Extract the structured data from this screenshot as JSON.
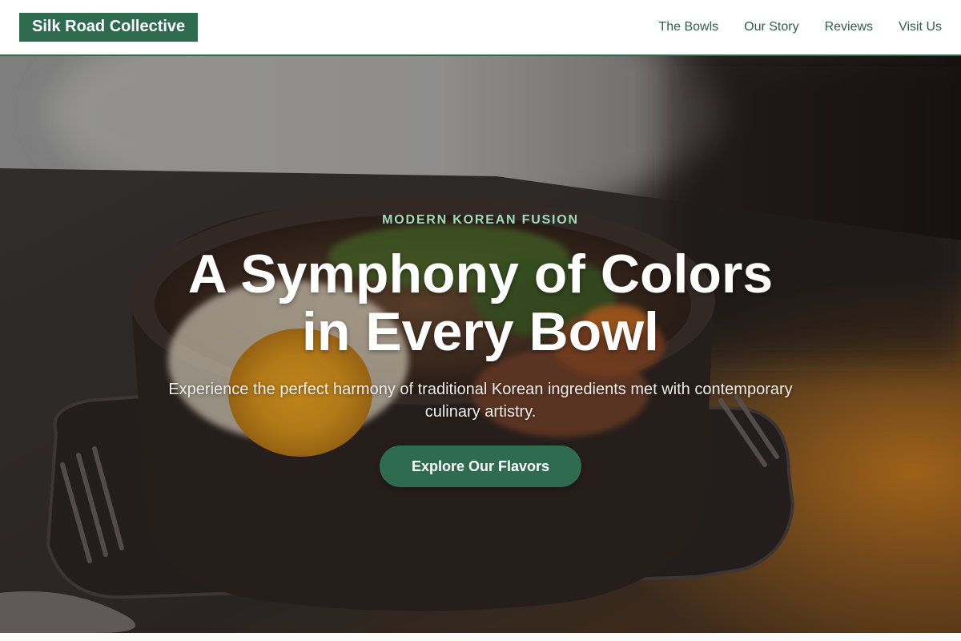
{
  "header": {
    "logo": "Silk Road Collective",
    "nav": [
      {
        "label": "The Bowls"
      },
      {
        "label": "Our Story"
      },
      {
        "label": "Reviews"
      },
      {
        "label": "Visit Us"
      }
    ]
  },
  "hero": {
    "eyebrow": "MODERN KOREAN FUSION",
    "headline_line1": "A Symphony of Colors",
    "headline_line2": "in Every Bowl",
    "subtitle": "Experience the perfect harmony of traditional Korean ingredients met with contemporary culinary artistry.",
    "cta_label": "Explore Our Flavors",
    "image_alt": "bibimbap stone bowl photo"
  },
  "colors": {
    "brand_green": "#2e6b4f",
    "eyebrow_mint": "#9fdcbc",
    "white": "#ffffff"
  }
}
